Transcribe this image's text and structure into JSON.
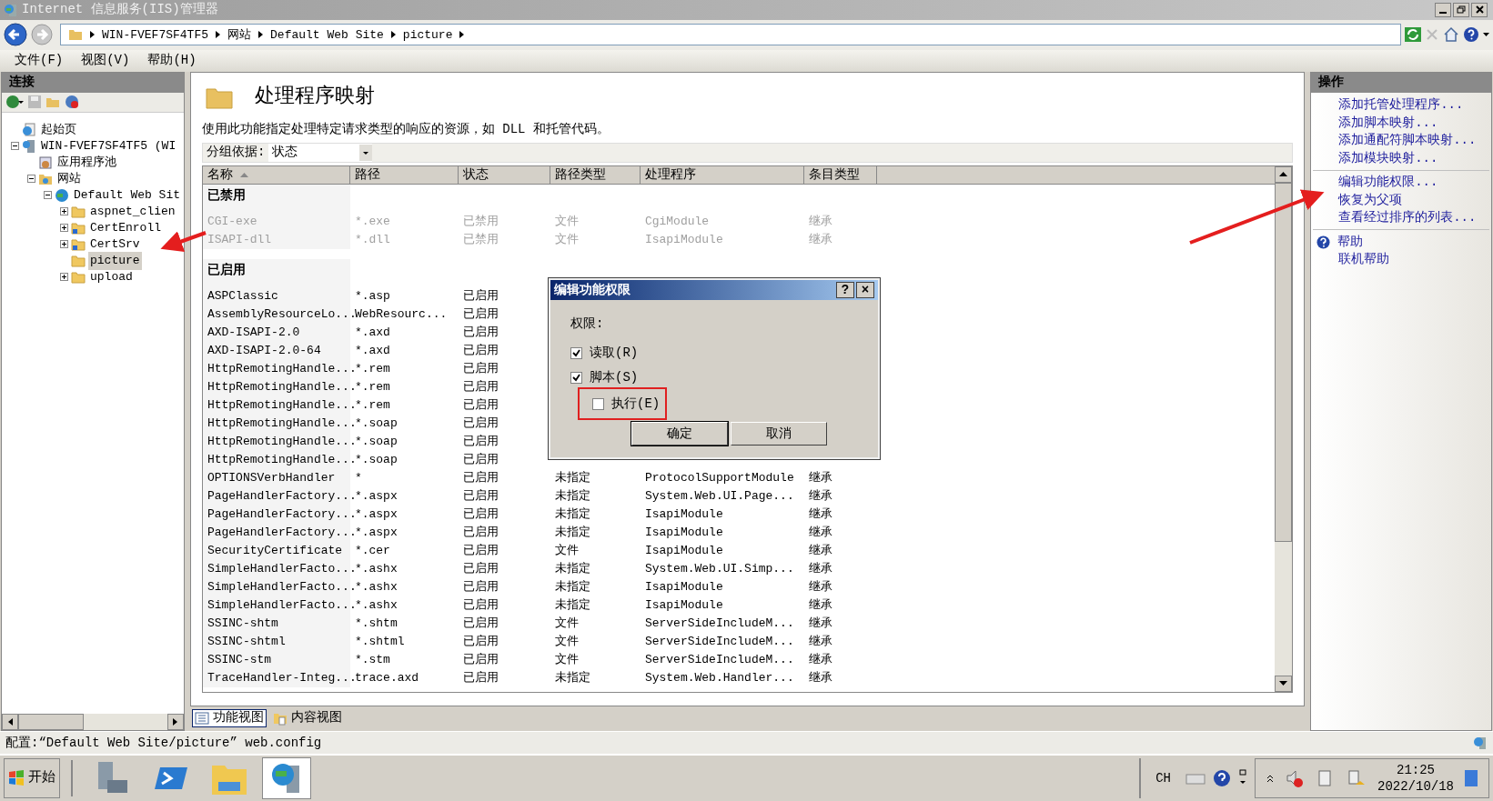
{
  "window": {
    "title": "Internet 信息服务(IIS)管理器"
  },
  "address_bar": {
    "segments": [
      "WIN-FVEF7SF4TF5",
      "网站",
      "Default Web Site",
      "picture"
    ]
  },
  "menu": [
    "文件(F)",
    "视图(V)",
    "帮助(H)"
  ],
  "connections": {
    "title": "连接",
    "tree": [
      {
        "label": "起始页",
        "kind": "home",
        "selected": false
      },
      {
        "label": "WIN-FVEF7SF4TF5 (WI",
        "kind": "server",
        "selected": false,
        "expanded": true,
        "children": [
          {
            "label": "应用程序池",
            "kind": "pool",
            "selected": false
          },
          {
            "label": "网站",
            "kind": "sites",
            "selected": false,
            "expanded": true,
            "children": [
              {
                "label": "Default Web Sit",
                "kind": "site",
                "selected": false,
                "expanded": true,
                "children": [
                  {
                    "label": "aspnet_clien",
                    "kind": "folder",
                    "selected": false,
                    "expanded": false
                  },
                  {
                    "label": "CertEnroll",
                    "kind": "app",
                    "selected": false,
                    "expanded": false
                  },
                  {
                    "label": "CertSrv",
                    "kind": "app",
                    "selected": false,
                    "expanded": false
                  },
                  {
                    "label": "picture",
                    "kind": "folder",
                    "selected": true
                  },
                  {
                    "label": "upload",
                    "kind": "folder",
                    "selected": false,
                    "expanded": false
                  }
                ]
              }
            ]
          }
        ]
      }
    ]
  },
  "feature": {
    "title": "处理程序映射",
    "description": "使用此功能指定处理特定请求类型的响应的资源，如 DLL 和托管代码。",
    "group_by": {
      "label": "分组依据:",
      "value": "状态"
    },
    "columns": [
      {
        "label": "名称",
        "sorted": true
      },
      {
        "label": "路径",
        "sorted": false
      },
      {
        "label": "状态",
        "sorted": false
      },
      {
        "label": "路径类型",
        "sorted": false
      },
      {
        "label": "处理程序",
        "sorted": false
      },
      {
        "label": "条目类型",
        "sorted": false
      }
    ],
    "groups": [
      {
        "label": "已禁用",
        "greyed": true,
        "rows": [
          {
            "name": "CGI-exe",
            "path": "*.exe",
            "status": "已禁用",
            "path_type": "文件",
            "handler": "CgiModule",
            "entry_type": "继承"
          },
          {
            "name": "ISAPI-dll",
            "path": "*.dll",
            "status": "已禁用",
            "path_type": "文件",
            "handler": "IsapiModule",
            "entry_type": "继承"
          }
        ]
      },
      {
        "label": "已启用",
        "greyed": false,
        "rows": [
          {
            "name": "ASPClassic",
            "path": "*.asp",
            "status": "已启用"
          },
          {
            "name": "AssemblyResourceLo...",
            "path": "WebResourc...",
            "status": "已启用"
          },
          {
            "name": "AXD-ISAPI-2.0",
            "path": "*.axd",
            "status": "已启用"
          },
          {
            "name": "AXD-ISAPI-2.0-64",
            "path": "*.axd",
            "status": "已启用"
          },
          {
            "name": "HttpRemotingHandle...",
            "path": "*.rem",
            "status": "已启用"
          },
          {
            "name": "HttpRemotingHandle...",
            "path": "*.rem",
            "status": "已启用"
          },
          {
            "name": "HttpRemotingHandle...",
            "path": "*.rem",
            "status": "已启用"
          },
          {
            "name": "HttpRemotingHandle...",
            "path": "*.soap",
            "status": "已启用"
          },
          {
            "name": "HttpRemotingHandle...",
            "path": "*.soap",
            "status": "已启用"
          },
          {
            "name": "HttpRemotingHandle...",
            "path": "*.soap",
            "status": "已启用"
          },
          {
            "name": "OPTIONSVerbHandler",
            "path": "*",
            "status": "已启用",
            "path_type": "未指定",
            "handler": "ProtocolSupportModule",
            "entry_type": "继承"
          },
          {
            "name": "PageHandlerFactory...",
            "path": "*.aspx",
            "status": "已启用",
            "path_type": "未指定",
            "handler": "System.Web.UI.Page...",
            "entry_type": "继承"
          },
          {
            "name": "PageHandlerFactory...",
            "path": "*.aspx",
            "status": "已启用",
            "path_type": "未指定",
            "handler": "IsapiModule",
            "entry_type": "继承"
          },
          {
            "name": "PageHandlerFactory...",
            "path": "*.aspx",
            "status": "已启用",
            "path_type": "未指定",
            "handler": "IsapiModule",
            "entry_type": "继承"
          },
          {
            "name": "SecurityCertificate",
            "path": "*.cer",
            "status": "已启用",
            "path_type": "文件",
            "handler": "IsapiModule",
            "entry_type": "继承"
          },
          {
            "name": "SimpleHandlerFacto...",
            "path": "*.ashx",
            "status": "已启用",
            "path_type": "未指定",
            "handler": "System.Web.UI.Simp...",
            "entry_type": "继承"
          },
          {
            "name": "SimpleHandlerFacto...",
            "path": "*.ashx",
            "status": "已启用",
            "path_type": "未指定",
            "handler": "IsapiModule",
            "entry_type": "继承"
          },
          {
            "name": "SimpleHandlerFacto...",
            "path": "*.ashx",
            "status": "已启用",
            "path_type": "未指定",
            "handler": "IsapiModule",
            "entry_type": "继承"
          },
          {
            "name": "SSINC-shtm",
            "path": "*.shtm",
            "status": "已启用",
            "path_type": "文件",
            "handler": "ServerSideIncludeM...",
            "entry_type": "继承"
          },
          {
            "name": "SSINC-shtml",
            "path": "*.shtml",
            "status": "已启用",
            "path_type": "文件",
            "handler": "ServerSideIncludeM...",
            "entry_type": "继承"
          },
          {
            "name": "SSINC-stm",
            "path": "*.stm",
            "status": "已启用",
            "path_type": "文件",
            "handler": "ServerSideIncludeM...",
            "entry_type": "继承"
          },
          {
            "name": "TraceHandler-Integ...",
            "path": "trace.axd",
            "status": "已启用",
            "path_type": "未指定",
            "handler": "System.Web.Handler...",
            "entry_type": "继承"
          }
        ]
      }
    ]
  },
  "view_tabs": [
    {
      "label": "功能视图",
      "selected": true
    },
    {
      "label": "内容视图",
      "selected": false
    }
  ],
  "actions": {
    "title": "操作",
    "sections": [
      [
        {
          "label": "添加托管处理程序...",
          "kind": "link"
        },
        {
          "label": "添加脚本映射...",
          "kind": "link"
        },
        {
          "label": "添加通配符脚本映射...",
          "kind": "link"
        },
        {
          "label": "添加模块映射...",
          "kind": "link"
        }
      ],
      [
        {
          "label": "编辑功能权限...",
          "kind": "link"
        },
        {
          "label": "恢复为父项",
          "kind": "link"
        },
        {
          "label": "查看经过排序的列表...",
          "kind": "link"
        }
      ],
      [
        {
          "label": "帮助",
          "kind": "help"
        },
        {
          "label": "联机帮助",
          "kind": "link"
        }
      ]
    ]
  },
  "status_bar": "配置:“Default Web Site/picture” web.config",
  "dialog": {
    "title": "编辑功能权限",
    "title_buttons": [
      "?",
      "×"
    ],
    "group_label": "权限:",
    "options": [
      {
        "label": "读取(R)",
        "checked": true,
        "indented": false
      },
      {
        "label": "脚本(S)",
        "checked": true,
        "indented": false
      },
      {
        "label": "执行(E)",
        "checked": false,
        "indented": true
      }
    ],
    "buttons": [
      "确定",
      "取消"
    ]
  },
  "taskbar": {
    "start": "开始",
    "language": "CH",
    "time": "21:25",
    "date": "2022/10/18"
  }
}
